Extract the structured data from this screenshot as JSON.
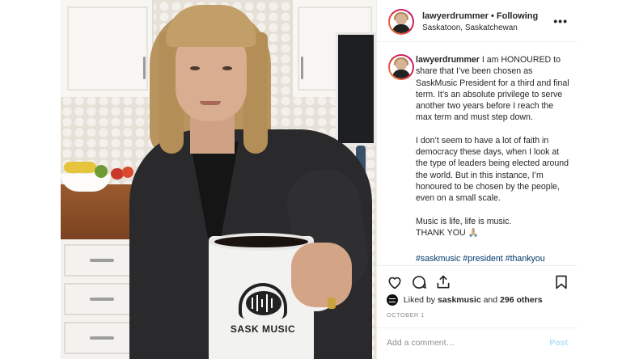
{
  "header": {
    "username": "lawyerdrummer",
    "separator": "•",
    "follow_status": "Following",
    "location": "Saskatoon, Saskatchewan",
    "more": "•••"
  },
  "caption": {
    "username": "lawyerdrummer",
    "para1": "I am HONOURED to share that I’ve been chosen as SaskMusic President for a third and final term. It’s an absolute privilege to serve another two years before I reach the max term and must step down.",
    "para2": "I don’t seem to have a lot of faith in democracy these days, when I look at the type of leaders being elected around the world. But in this instance, I’m honoured to be chosen by the people, even on a small scale.",
    "para3": "Music is life, life is music.",
    "para4": "THANK YOU 🙏🏼",
    "hashtags": "#saskmusic #president #thankyou"
  },
  "actions": {
    "icons": [
      "heart-icon",
      "comment-icon",
      "share-icon",
      "bookmark-icon"
    ]
  },
  "likes": {
    "prefix": "Liked by",
    "user": "saskmusic",
    "connector": "and",
    "others": "296 others"
  },
  "date": "OCTOBER 1",
  "comment": {
    "placeholder": "Add a comment…",
    "post_label": "Post"
  },
  "photo": {
    "mug_text": "SASK MUSIC"
  },
  "colors": {
    "link": "#00376b",
    "muted": "#8e8e8e",
    "post_button": "#b2dffc",
    "border": "#efefef"
  }
}
